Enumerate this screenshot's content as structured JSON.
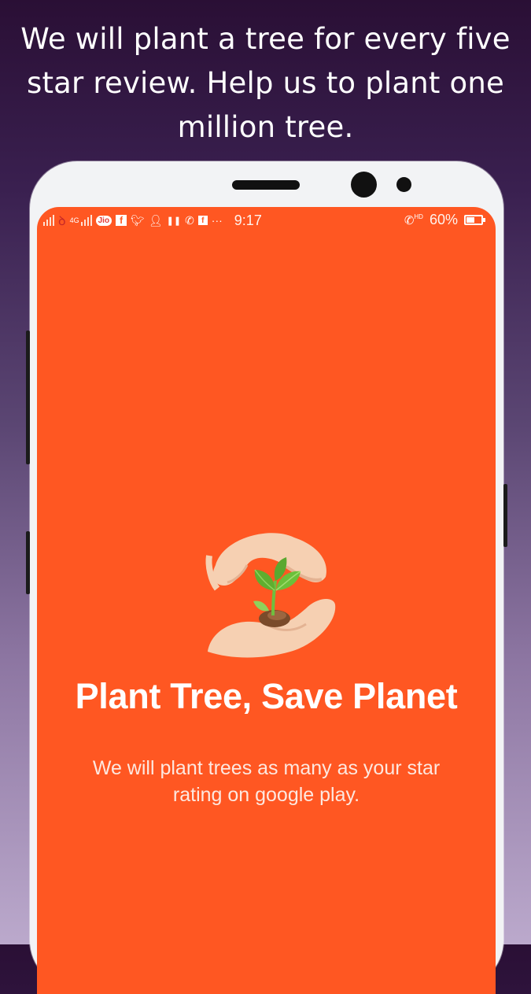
{
  "headline": "We will plant a tree for every five star review. Help us to plant one million tree.",
  "status_bar": {
    "network_label": "4G",
    "carrier_badge": "Jio",
    "time": "9:17",
    "call_label": "HD",
    "battery": "60%",
    "battery_level": 0.6,
    "notification_icons": [
      "facebook-icon",
      "twitter-icon",
      "user-icon",
      "pause-icon",
      "whatsapp-icon",
      "facebook-icon",
      "more-icon"
    ]
  },
  "screen": {
    "title": "Plant Tree, Save Planet",
    "subtitle": "We will plant trees as many as your star rating on google play.",
    "background_color": "#ff5722",
    "illustration": "hands-holding-sapling-icon"
  }
}
